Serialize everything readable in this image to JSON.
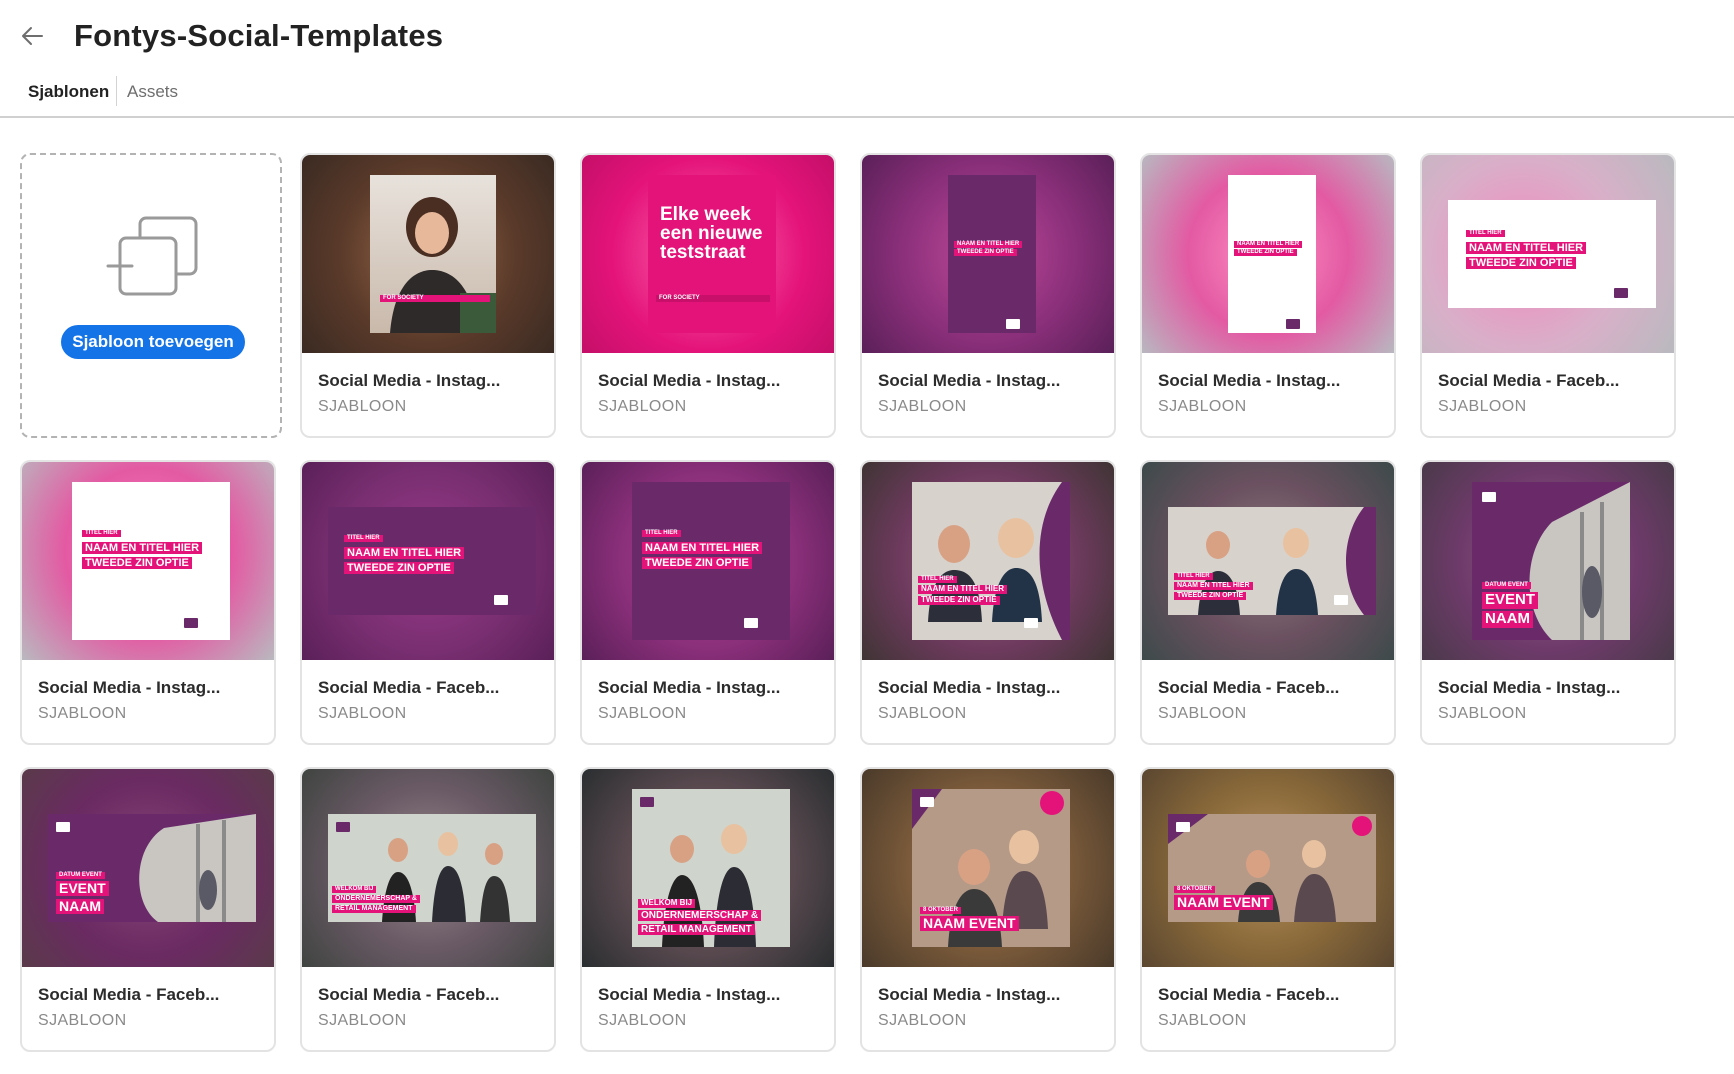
{
  "header": {
    "title": "Fontys-Social-Templates",
    "back_icon": "arrow-left-icon"
  },
  "tabs": [
    {
      "label": "Sjablonen",
      "active": true
    },
    {
      "label": "Assets",
      "active": false
    }
  ],
  "add_card": {
    "button_label": "Sjabloon toevoegen",
    "icon": "add-template-icon"
  },
  "colors": {
    "accent": "#1473e6",
    "brand_pink": "#e4137a",
    "brand_purple": "#6a2a6a"
  },
  "cards": [
    {
      "title": "Social Media - Instag...",
      "type": "SJABLOON",
      "thumb": {
        "ribbon": "FOR SOCIETY"
      }
    },
    {
      "title": "Social Media - Instag...",
      "type": "SJABLOON",
      "thumb": {
        "headline": "Elke week een nieuwe teststraat",
        "ribbon": "FOR SOCIETY"
      }
    },
    {
      "title": "Social Media - Instag...",
      "type": "SJABLOON",
      "thumb": {
        "line1": "NAAM EN TITEL HIER",
        "line2": "TWEEDE ZIN OPTIE"
      }
    },
    {
      "title": "Social Media - Instag...",
      "type": "SJABLOON",
      "thumb": {
        "line1": "NAAM EN TITEL HIER",
        "line2": "TWEEDE ZIN OPTIE"
      }
    },
    {
      "title": "Social Media - Faceb...",
      "type": "SJABLOON",
      "thumb": {
        "small": "TITEL HIER",
        "line1": "NAAM EN TITEL HIER",
        "line2": "TWEEDE ZIN OPTIE"
      }
    },
    {
      "title": "Social Media - Instag...",
      "type": "SJABLOON",
      "thumb": {
        "small": "TITEL HIER",
        "line1": "NAAM EN TITEL HIER",
        "line2": "TWEEDE ZIN OPTIE"
      }
    },
    {
      "title": "Social Media - Faceb...",
      "type": "SJABLOON",
      "thumb": {
        "small": "TITEL HIER",
        "line1": "NAAM EN TITEL HIER",
        "line2": "TWEEDE ZIN OPTIE"
      }
    },
    {
      "title": "Social Media - Instag...",
      "type": "SJABLOON",
      "thumb": {
        "small": "TITEL HIER",
        "line1": "NAAM EN TITEL HIER",
        "line2": "TWEEDE ZIN OPTIE"
      }
    },
    {
      "title": "Social Media - Instag...",
      "type": "SJABLOON",
      "thumb": {
        "small": "TITEL HIER",
        "line1": "NAAM EN TITEL HIER",
        "line2": "TWEEDE ZIN OPTIE"
      }
    },
    {
      "title": "Social Media - Faceb...",
      "type": "SJABLOON",
      "thumb": {
        "small": "TITEL HIER",
        "line1": "NAAM EN TITEL HIER",
        "line2": "TWEEDE ZIN OPTIE"
      }
    },
    {
      "title": "Social Media - Instag...",
      "type": "SJABLOON",
      "thumb": {
        "small": "DATUM EVENT",
        "line1": "EVENT",
        "line2": "NAAM"
      }
    },
    {
      "title": "Social Media - Faceb...",
      "type": "SJABLOON",
      "thumb": {
        "small": "DATUM EVENT",
        "line1": "EVENT",
        "line2": "NAAM"
      }
    },
    {
      "title": "Social Media - Faceb...",
      "type": "SJABLOON",
      "thumb": {
        "small": "WELKOM BIJ",
        "line1": "ONDERNEMERSCHAP &",
        "line2": "RETAIL MANAGEMENT"
      }
    },
    {
      "title": "Social Media - Instag...",
      "type": "SJABLOON",
      "thumb": {
        "small": "WELKOM BIJ",
        "line1": "ONDERNEMERSCHAP &",
        "line2": "RETAIL MANAGEMENT"
      }
    },
    {
      "title": "Social Media - Instag...",
      "type": "SJABLOON",
      "thumb": {
        "small": "8 OKTOBER",
        "line1": "NAAM EVENT"
      }
    },
    {
      "title": "Social Media - Faceb...",
      "type": "SJABLOON",
      "thumb": {
        "small": "8 OKTOBER",
        "line1": "NAAM EVENT"
      }
    }
  ]
}
